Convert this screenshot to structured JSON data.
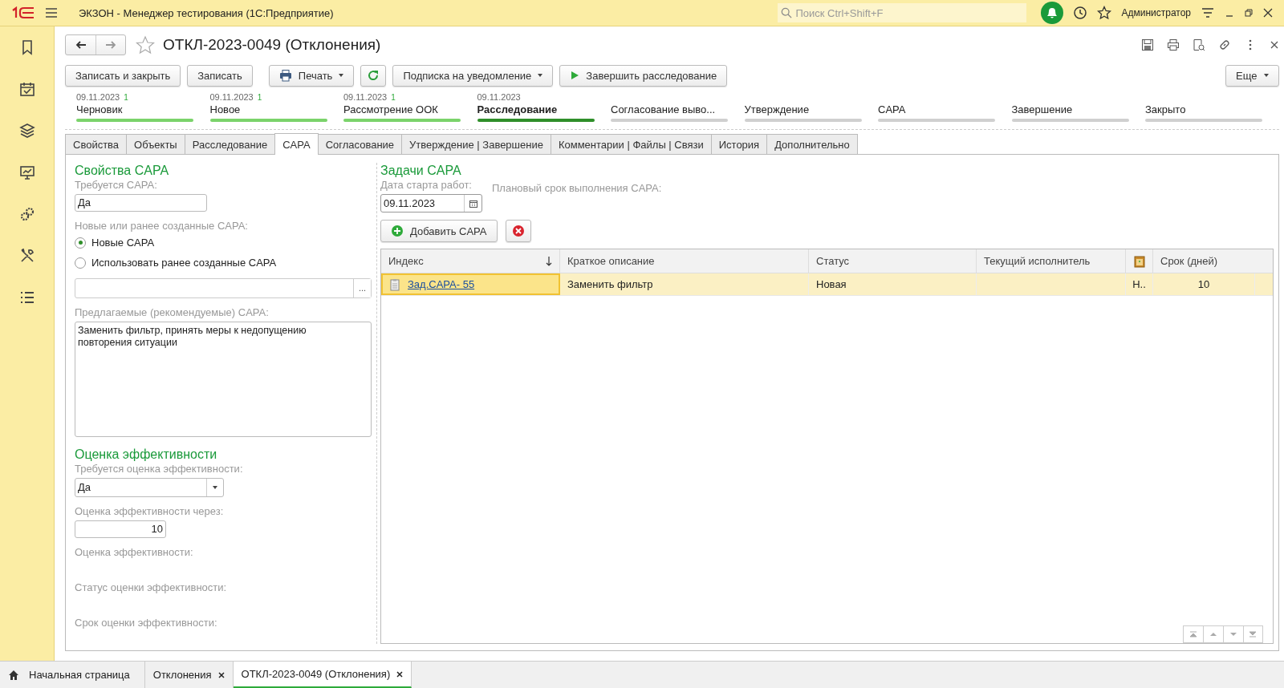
{
  "window": {
    "title": "ЭКЗОН  - Менеджер тестирования (1С:Предприятие)",
    "search_placeholder": "Поиск Ctrl+Shift+F",
    "user": "Администратор"
  },
  "form": {
    "title": "ОТКЛ-2023-0049 (Отклонения)",
    "favorite": false
  },
  "commands": [
    {
      "kind": "plain",
      "label": "Записать и закрыть"
    },
    {
      "kind": "plain",
      "label": "Записать"
    },
    {
      "kind": "print",
      "label": "Печать"
    },
    {
      "kind": "refresh"
    },
    {
      "kind": "dropdown",
      "label": "Подписка на уведомление"
    },
    {
      "kind": "play",
      "label": "Завершить расследование"
    }
  ],
  "more_button": "Еще",
  "stages": [
    {
      "date": "09.11.2023",
      "count": "1",
      "label": "Черновик",
      "done": true,
      "current": false
    },
    {
      "date": "09.11.2023",
      "count": "1",
      "label": "Новое",
      "done": true,
      "current": false
    },
    {
      "date": "09.11.2023",
      "count": "1",
      "label": "Рассмотрение ООК",
      "done": true,
      "current": false
    },
    {
      "date": "09.11.2023",
      "label": "Расследование",
      "done": false,
      "current": true
    },
    {
      "label": "Согласование выво...",
      "done": false,
      "current": false
    },
    {
      "label": "Утверждение",
      "done": false,
      "current": false
    },
    {
      "label": "CAPA",
      "done": false,
      "current": false
    },
    {
      "label": "Завершение",
      "done": false,
      "current": false
    },
    {
      "label": "Закрыто",
      "done": false,
      "current": false
    }
  ],
  "tabs": [
    {
      "label": "Свойства",
      "selected": false
    },
    {
      "label": "Объекты",
      "selected": false
    },
    {
      "label": "Расследование",
      "selected": false
    },
    {
      "label": "CAPA",
      "selected": true
    },
    {
      "label": "Согласование",
      "selected": false
    },
    {
      "label": "Утверждение | Завершение",
      "selected": false
    },
    {
      "label": "Комментарии | Файлы | Связи",
      "selected": false
    },
    {
      "label": "История",
      "selected": false
    },
    {
      "label": "Дополнительно",
      "selected": false
    }
  ],
  "capa_properties": {
    "heading": "Свойства CAPA",
    "required_label": "Требуется CAPA:",
    "required_value": "Да",
    "source_label": "Новые или ранее созданные CAPA:",
    "options": [
      {
        "label": "Новые CAPA",
        "selected": true
      },
      {
        "label": "Использовать ранее созданные CAPA",
        "selected": false
      }
    ],
    "select_button": "...",
    "recommended_label": "Предлагаемые (рекомендуемые) CAPA:",
    "recommended_text": "Заменить фильтр, принять меры к недопущению\nповторения ситуации"
  },
  "efficiency": {
    "heading": "Оценка эффективности",
    "required_label": "Требуется оценка эффективности:",
    "required_value": "Да",
    "after_label": "Оценка эффективности через:",
    "after_value": "10",
    "labels": [
      "Оценка эффективности:",
      "Статус оценки эффективности:",
      "Срок оценки эффективности:"
    ]
  },
  "tasks": {
    "heading": "Задачи  CAPA",
    "start_label": "Дата старта работ:",
    "start_value": "09.11.2023",
    "planned_label": "Плановый срок выполнения CAPA:",
    "add_button": "Добавить CAPA"
  },
  "table": {
    "columns": [
      {
        "kind": "text",
        "label": "Индекс",
        "sorted": true
      },
      {
        "kind": "text",
        "label": "Краткое описание",
        "sorted": false
      },
      {
        "kind": "text",
        "label": "Статус",
        "sorted": false
      },
      {
        "kind": "text",
        "label": "Текущий исполнитель",
        "sorted": false
      },
      {
        "kind": "icon",
        "sorted": false
      },
      {
        "kind": "text",
        "label": "Срок (дней)",
        "sorted": false
      }
    ],
    "rows": [
      {
        "selected": true,
        "index": "Зад.CAPA- 55",
        "description": "Заменить фильтр",
        "status": "Новая",
        "column_5": "Н..",
        "days": "10"
      }
    ]
  },
  "taskbar": [
    {
      "kind": "home",
      "label": "Начальная страница",
      "selected": false
    },
    {
      "kind": "closable",
      "label": "Отклонения",
      "selected": false
    },
    {
      "kind": "closable",
      "label": "ОТКЛ-2023-0049 (Отклонения)",
      "selected": true
    }
  ]
}
